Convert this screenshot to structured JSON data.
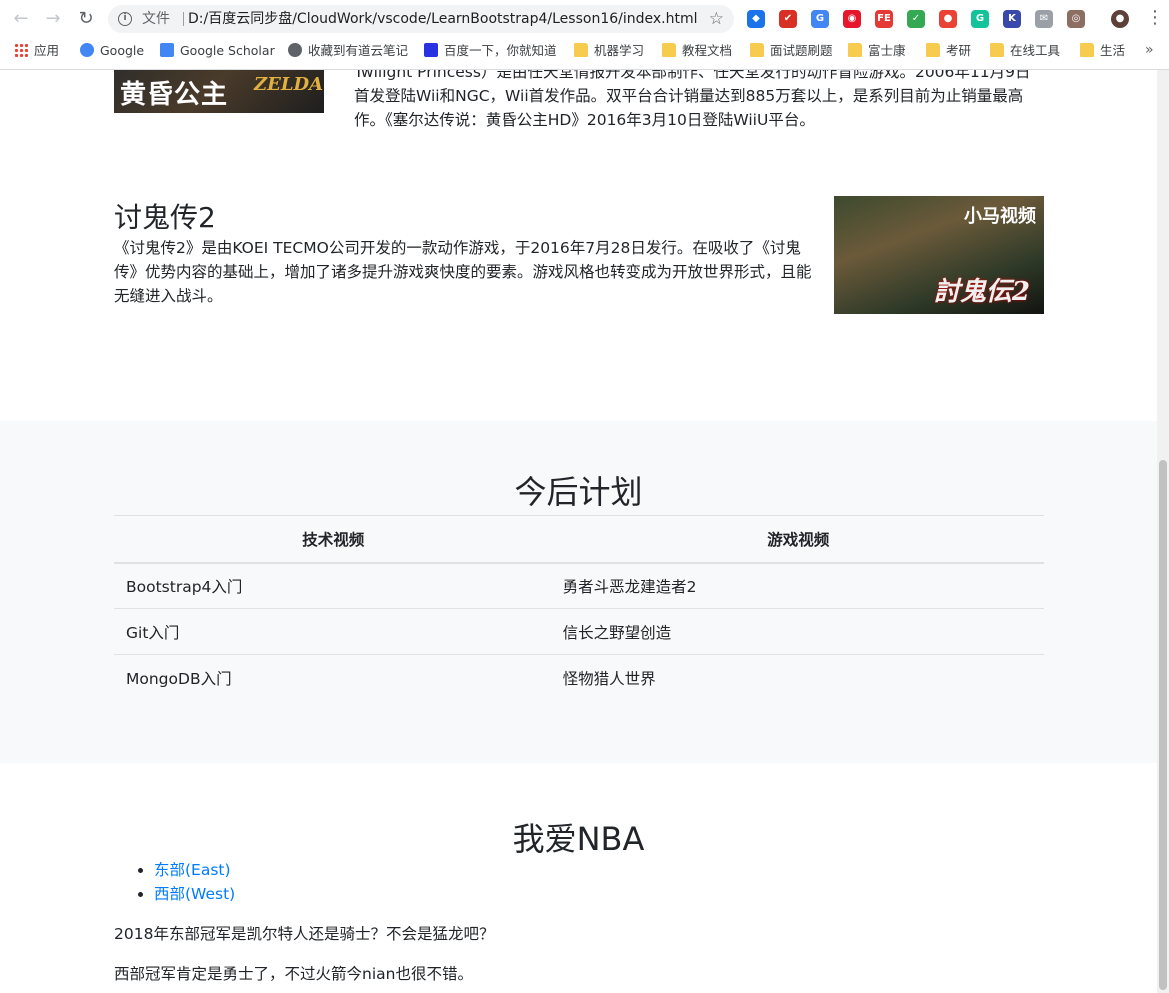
{
  "browser": {
    "scheme_label": "文件",
    "url": "D:/百度云同步盘/CloudWork/vscode/LearnBootstrap4/Lesson16/index.html",
    "extensions": [
      {
        "icon": "extension-blue-icon",
        "color": "#1a73e8"
      },
      {
        "icon": "extension-red-check-icon",
        "color": "#d93025"
      },
      {
        "icon": "extension-translate-icon",
        "color": "#4285f4"
      },
      {
        "icon": "extension-weibo-icon",
        "color": "#e6162d"
      },
      {
        "icon": "extension-fe-icon",
        "color": "#e53935"
      },
      {
        "icon": "extension-shield-icon",
        "color": "#34a853"
      },
      {
        "icon": "extension-map-pin-icon",
        "color": "#ea4335"
      },
      {
        "icon": "extension-grammarly-icon",
        "color": "#15c39a"
      },
      {
        "icon": "extension-k-icon",
        "color": "#3949ab"
      },
      {
        "icon": "extension-mail-icon",
        "color": "#9aa0a6"
      },
      {
        "icon": "extension-owl-icon",
        "color": "#8d6e63"
      },
      {
        "icon": "profile-avatar-icon",
        "color": "#5d4037"
      }
    ],
    "bookmarks": [
      {
        "label": "应用",
        "icon": "apps-grid-icon"
      },
      {
        "label": "Google",
        "icon": "google-icon"
      },
      {
        "label": "Google Scholar",
        "icon": "google-scholar-icon"
      },
      {
        "label": "收藏到有道云笔记",
        "icon": "globe-icon"
      },
      {
        "label": "百度一下，你就知道",
        "icon": "baidu-paw-icon"
      },
      {
        "label": "机器学习",
        "icon": "folder-icon"
      },
      {
        "label": "教程文档",
        "icon": "folder-icon"
      },
      {
        "label": "面试题刷题",
        "icon": "folder-icon"
      },
      {
        "label": "富士康",
        "icon": "folder-icon"
      },
      {
        "label": "考研",
        "icon": "folder-icon"
      },
      {
        "label": "在线工具",
        "icon": "folder-icon"
      },
      {
        "label": "生活",
        "icon": "folder-icon"
      }
    ],
    "more_bookmarks": "»"
  },
  "zelda": {
    "image_caption": "黄昏公主",
    "logo_text": "ZELDA",
    "text": "Twilight Princess）是由任天堂情报开发本部制作、任天堂发行的动作冒险游戏。2006年11月9日首发登陆Wii和NGC，Wii首发作品。双平台合计销量达到885万套以上，是系列目前为止销量最高作。《塞尔达传说：黄昏公主HD》2016年3月10日登陆WiiU平台。"
  },
  "onimusha": {
    "title": "讨鬼传2",
    "text": "《讨鬼传2》是由KOEI TECMO公司开发的一款动作游戏，于2016年7月28日发行。在吸收了《讨鬼传》优势内容的基础上，增加了诸多提升游戏爽快度的要素。游戏风格也转变成为开放世界形式，且能无缝进入战斗。",
    "image_watermark": "小马视频",
    "image_logo": "討鬼伝2"
  },
  "plan": {
    "title": "今后计划",
    "headers": [
      "技术视频",
      "游戏视频"
    ],
    "rows": [
      [
        "Bootstrap4入门",
        "勇者斗恶龙建造者2"
      ],
      [
        "Git入门",
        "信长之野望创造"
      ],
      [
        "MongoDB入门",
        "怪物猎人世界"
      ]
    ]
  },
  "nba": {
    "title": "我爱NBA",
    "links": [
      "东部(East)",
      "西部(West)"
    ],
    "paragraphs": [
      "2018年东部冠军是凯尔特人还是骑士？不会是猛龙吧？",
      "西部冠军肯定是勇士了，不过火箭今nian也很不错。"
    ]
  },
  "colors": {
    "link": "#007bff",
    "section_bg": "#f8f9fa",
    "text": "#212529"
  }
}
